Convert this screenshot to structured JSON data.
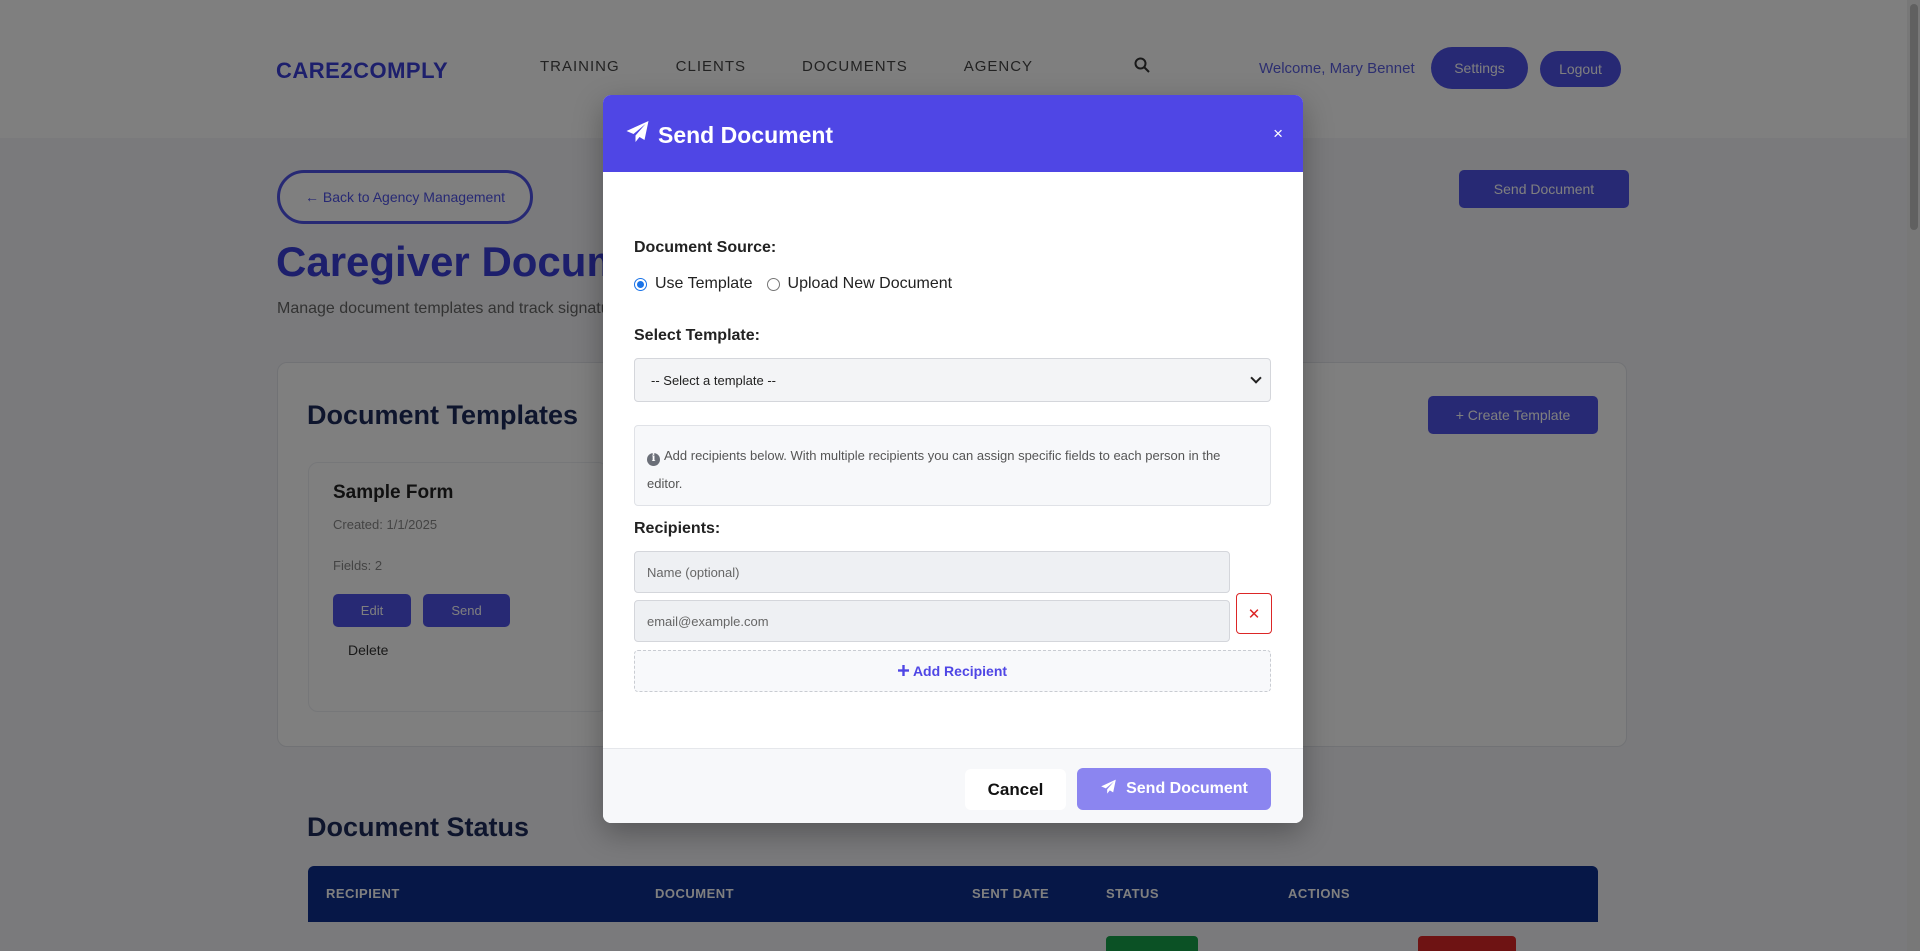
{
  "background": {
    "logo": "CARE2COMPLY",
    "nav_links": [
      "TRAINING",
      "CLIENTS",
      "DOCUMENTS",
      "AGENCY"
    ],
    "welcome": "Welcome, Mary Bennet",
    "settings_label": "Settings",
    "logout_label": "Logout",
    "back_label": "← Back to Agency Management",
    "send_doc_label": "Send Document",
    "page_title": "Caregiver Documents",
    "page_subtitle": "Manage document templates and track signatures",
    "templates_title": "Document Templates",
    "create_template_label": "+ Create Template",
    "template_name": "Sample Form",
    "template_created": "Created: 1/1/2025",
    "template_fields": "Fields: 2",
    "edit_label": "Edit",
    "send_label": "Send",
    "delete_label": "Delete",
    "status_title": "Document Status",
    "table_headers": [
      "RECIPIENT",
      "DOCUMENT",
      "SENT DATE",
      "STATUS",
      "ACTIONS"
    ],
    "accent": "#4f52e8",
    "table_header_color": "#0d2f8f"
  },
  "modal": {
    "title": "Send Document",
    "close_label": "×",
    "source_label": "Document Source:",
    "source_options": [
      "Use Template",
      "Upload New Document"
    ],
    "source_selected": "Use Template",
    "template_label": "Select Template:",
    "template_select": "-- Select a template --",
    "info_text": "Add recipients below. With multiple recipients you can assign specific fields to each person in the editor.",
    "recipients_label": "Recipients:",
    "name_placeholder": "Name (optional)",
    "email_placeholder": "email@example.com",
    "remove_label": "✕",
    "add_recipient_label": "Add Recipient",
    "cancel_label": "Cancel",
    "send_label": "Send Document",
    "header_color": "#4f46e5",
    "send_button_color": "#8b85f0"
  },
  "icons": {
    "title_icon": "paper-plane-icon",
    "info_icon": "info-circle-icon",
    "add_icon": "plus-icon",
    "remove_icon": "x-icon"
  }
}
